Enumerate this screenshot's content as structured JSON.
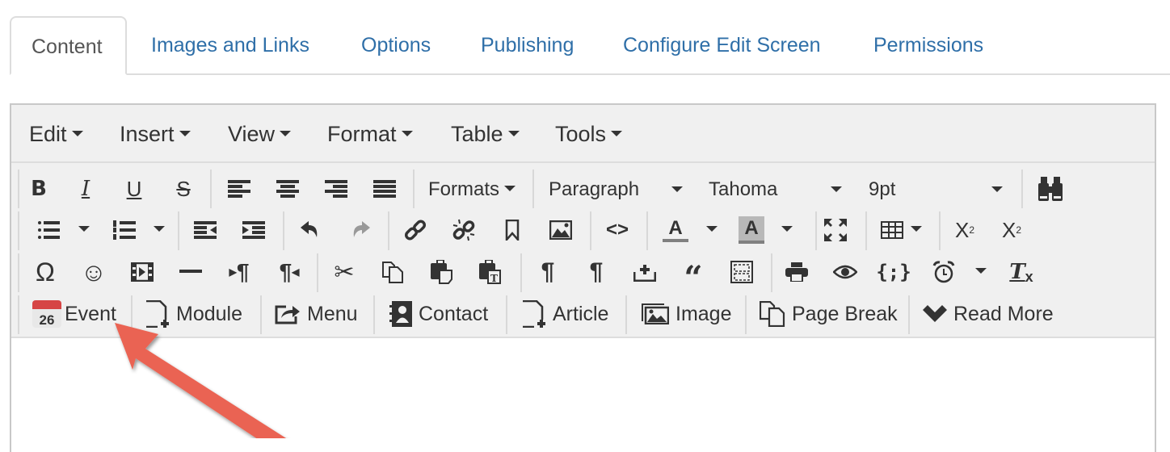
{
  "tabs": [
    {
      "label": "Content",
      "active": true
    },
    {
      "label": "Images and Links",
      "active": false
    },
    {
      "label": "Options",
      "active": false
    },
    {
      "label": "Publishing",
      "active": false
    },
    {
      "label": "Configure Edit Screen",
      "active": false
    },
    {
      "label": "Permissions",
      "active": false
    }
  ],
  "menubar": {
    "items": [
      "Edit",
      "Insert",
      "View",
      "Format",
      "Table",
      "Tools"
    ]
  },
  "toolbar": {
    "formats_label": "Formats",
    "block_format": "Paragraph",
    "font_family": "Tahoma",
    "font_size": "9pt",
    "icons": {
      "bold": "B",
      "italic": "I",
      "underline": "U",
      "strikethrough": "S",
      "special_char": "Ω",
      "emoticons": "☺",
      "hr": "—",
      "ltr": "¶",
      "rtl": "¶",
      "text_color_letter": "A",
      "bg_color_letter": "A",
      "subscript": "X",
      "subscript_small": "2",
      "superscript": "X",
      "superscript_small": "2",
      "code_sample": "{;}",
      "code": "<>",
      "clear_format": "T",
      "clear_format_x": "x",
      "calendar_day": "26"
    },
    "colors": {
      "text_underline": "#808080",
      "bg_highlight": "#b8b8b8"
    }
  },
  "buttons": [
    {
      "label": "Event",
      "icon": "calendar-icon"
    },
    {
      "label": "Module",
      "icon": "file-add-icon"
    },
    {
      "label": "Menu",
      "icon": "share-icon"
    },
    {
      "label": "Contact",
      "icon": "address-book-icon"
    },
    {
      "label": "Article",
      "icon": "file-add-icon"
    },
    {
      "label": "Image",
      "icon": "pictures-icon"
    },
    {
      "label": "Page Break",
      "icon": "copy-icon"
    },
    {
      "label": "Read More",
      "icon": "chevron-down-icon"
    }
  ],
  "annotation": {
    "color": "#ea6453"
  }
}
